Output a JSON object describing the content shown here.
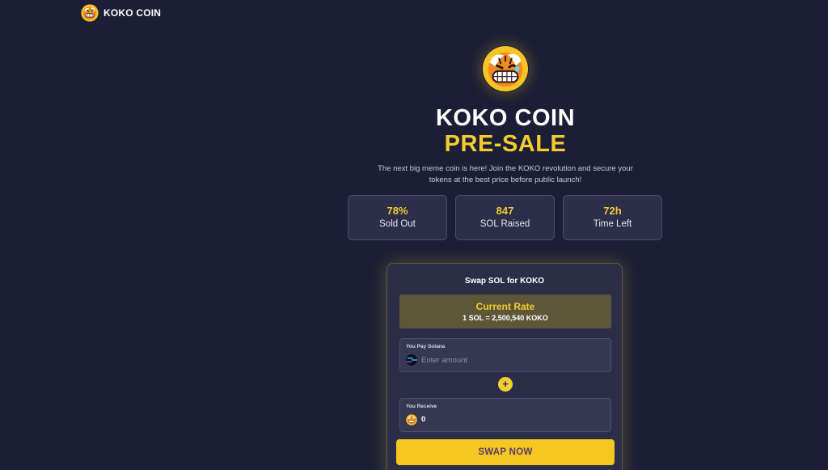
{
  "navbar": {
    "brand_name": "KOKO COIN",
    "logo_icon": "tiger-mascot-icon"
  },
  "hero": {
    "logo_icon": "tiger-mascot-icon",
    "title": "KOKO COIN",
    "subtitle": "PRE-SALE",
    "description": "The next big meme coin is here! Join the KOKO revolution and secure your tokens at the best price before public launch!"
  },
  "stats": [
    {
      "value": "78%",
      "label": "Sold Out"
    },
    {
      "value": "847",
      "label": "SOL Raised"
    },
    {
      "value": "72h",
      "label": "Time Left"
    }
  ],
  "swap": {
    "title": "Swap SOL for KOKO",
    "rate_label": "Current Rate",
    "rate_value": "1 SOL = 2,500,540 KOKO",
    "pay": {
      "label": "You Pay Solana",
      "placeholder": "Enter amount",
      "icon": "solana-icon"
    },
    "plus_icon": "plus-icon",
    "receive": {
      "label": "You Receive",
      "value": "0",
      "icon": "tiger-mascot-icon"
    },
    "button_label": "SWAP NOW"
  },
  "colors": {
    "background": "#1b1e35",
    "accent": "#f3cc2f",
    "card": "#2a2e47",
    "button_text": "#5a3a6b"
  }
}
